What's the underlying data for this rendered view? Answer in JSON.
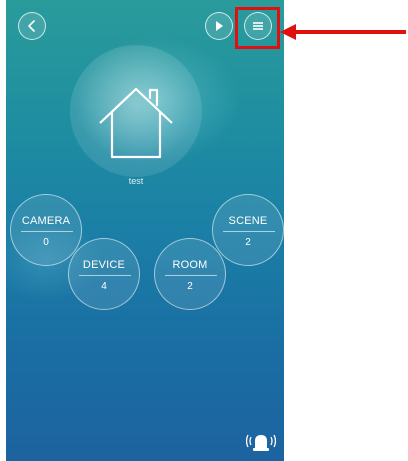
{
  "home": {
    "name": "test"
  },
  "nodes": {
    "camera": {
      "label": "CAMERA",
      "count": "0"
    },
    "scene": {
      "label": "SCENE",
      "count": "2"
    },
    "device": {
      "label": "DEVICE",
      "count": "4"
    },
    "room": {
      "label": "ROOM",
      "count": "2"
    }
  },
  "icons": {
    "back": "chevron-left-icon",
    "play": "play-icon",
    "menu": "hamburger-menu-icon",
    "home": "house-icon",
    "alarm": "alarm-siren-icon"
  },
  "colors": {
    "annotation": "#e01010",
    "background_top": "#2a9b9b",
    "background_bottom": "#1c63a0"
  }
}
